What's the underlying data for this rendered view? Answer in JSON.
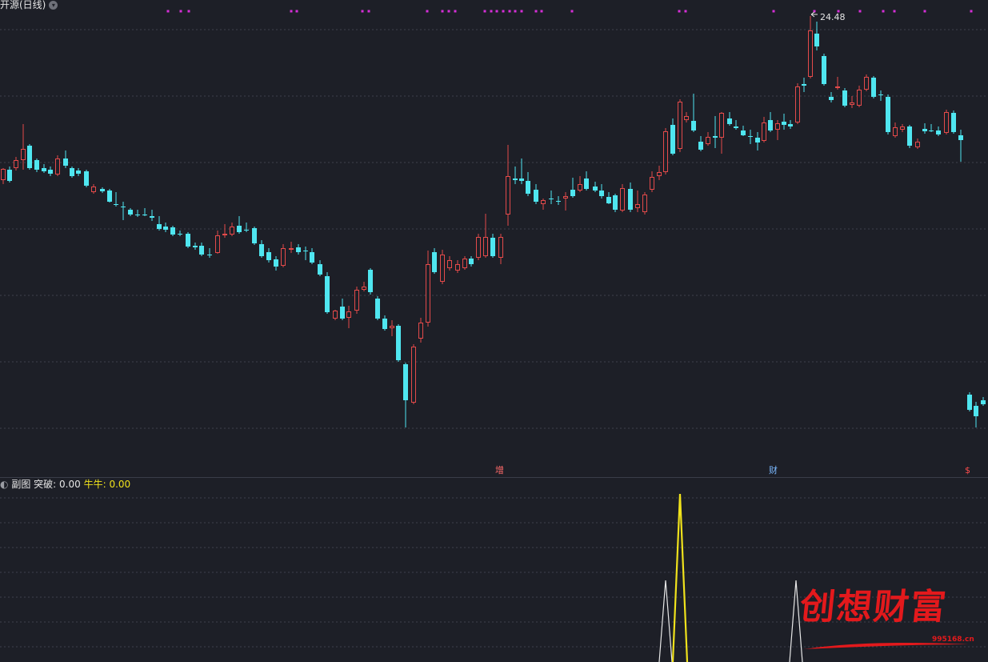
{
  "header": {
    "title": "开源(日线)",
    "chevron_icon": "chevron-down-icon"
  },
  "price_chart": {
    "peak_label": "24.48",
    "up_color": "#e34a4a",
    "down_color": "#4fe6f0",
    "markers": [
      {
        "text": "增",
        "color": "#ff6a6a"
      },
      {
        "text": "财",
        "color": "#7ab8ff"
      },
      {
        "text": "$",
        "color": "#ff4d4d"
      }
    ]
  },
  "sub_chart": {
    "name": "副图",
    "indicator1_label": "突破:",
    "indicator1_value": "0.00",
    "indicator2_label": "牛牛:",
    "indicator2_value": "0.00",
    "white_color": "#e8e8e8",
    "yellow_color": "#f0e21c"
  },
  "watermark": {
    "text": "创想财富",
    "url": "995168.cn",
    "color": "#e3191c"
  }
}
